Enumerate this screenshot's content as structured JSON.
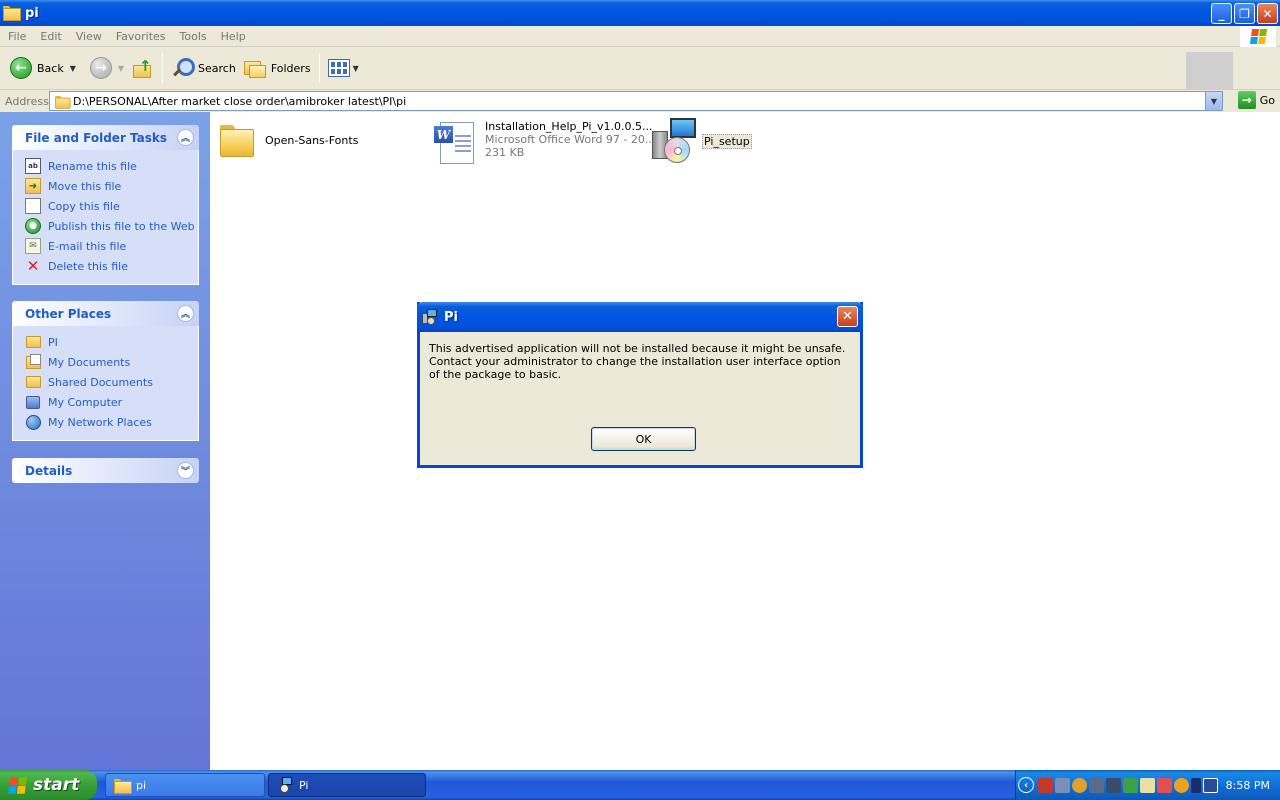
{
  "window": {
    "title": "pi",
    "buttons": {
      "minimize": "_",
      "maximize": "❐",
      "close": "✕"
    }
  },
  "menu": [
    "File",
    "Edit",
    "View",
    "Favorites",
    "Tools",
    "Help"
  ],
  "toolbar": {
    "back": "Back",
    "search": "Search",
    "folders": "Folders"
  },
  "address": {
    "label": "Address",
    "value": "D:\\PERSONAL\\After market close order\\amibroker latest\\PI\\pi",
    "go": "Go"
  },
  "sidebar": {
    "file_tasks": {
      "title": "File and Folder Tasks",
      "items": [
        {
          "label": "Rename this file",
          "icon": "rename-icon"
        },
        {
          "label": "Move this file",
          "icon": "move-icon"
        },
        {
          "label": "Copy this file",
          "icon": "copy-icon"
        },
        {
          "label": "Publish this file to the Web",
          "icon": "publish-icon"
        },
        {
          "label": "E-mail this file",
          "icon": "email-icon"
        },
        {
          "label": "Delete this file",
          "icon": "delete-icon"
        }
      ]
    },
    "other_places": {
      "title": "Other Places",
      "items": [
        {
          "label": "PI",
          "icon": "folder-icon"
        },
        {
          "label": "My Documents",
          "icon": "my-documents-icon"
        },
        {
          "label": "Shared Documents",
          "icon": "folder-icon"
        },
        {
          "label": "My Computer",
          "icon": "my-computer-icon"
        },
        {
          "label": "My Network Places",
          "icon": "network-icon"
        }
      ]
    },
    "details": {
      "title": "Details"
    }
  },
  "files": [
    {
      "name": "Open-Sans-Fonts",
      "type": "folder"
    },
    {
      "name": "Installation_Help_Pi_v1.0.0.5...",
      "desc": "Microsoft Office Word 97 - 20...",
      "size": "231 KB",
      "type": "word"
    },
    {
      "name": "Pi_setup",
      "type": "setup",
      "selected": true
    }
  ],
  "dialog": {
    "title": "Pi",
    "message": "This advertised application will not be installed because it might be unsafe. Contact your administrator to change the installation user interface option of the package to basic.",
    "ok": "OK"
  },
  "taskbar": {
    "start": "start",
    "buttons": [
      "pi",
      "Pi"
    ],
    "clock": "8:58 PM"
  },
  "colors": {
    "xp_blue": "#0054e3",
    "task_link": "#215dc6",
    "pane_top": "#7ba2e7",
    "pane_bottom": "#6375d6",
    "start_green": "#37a037"
  }
}
